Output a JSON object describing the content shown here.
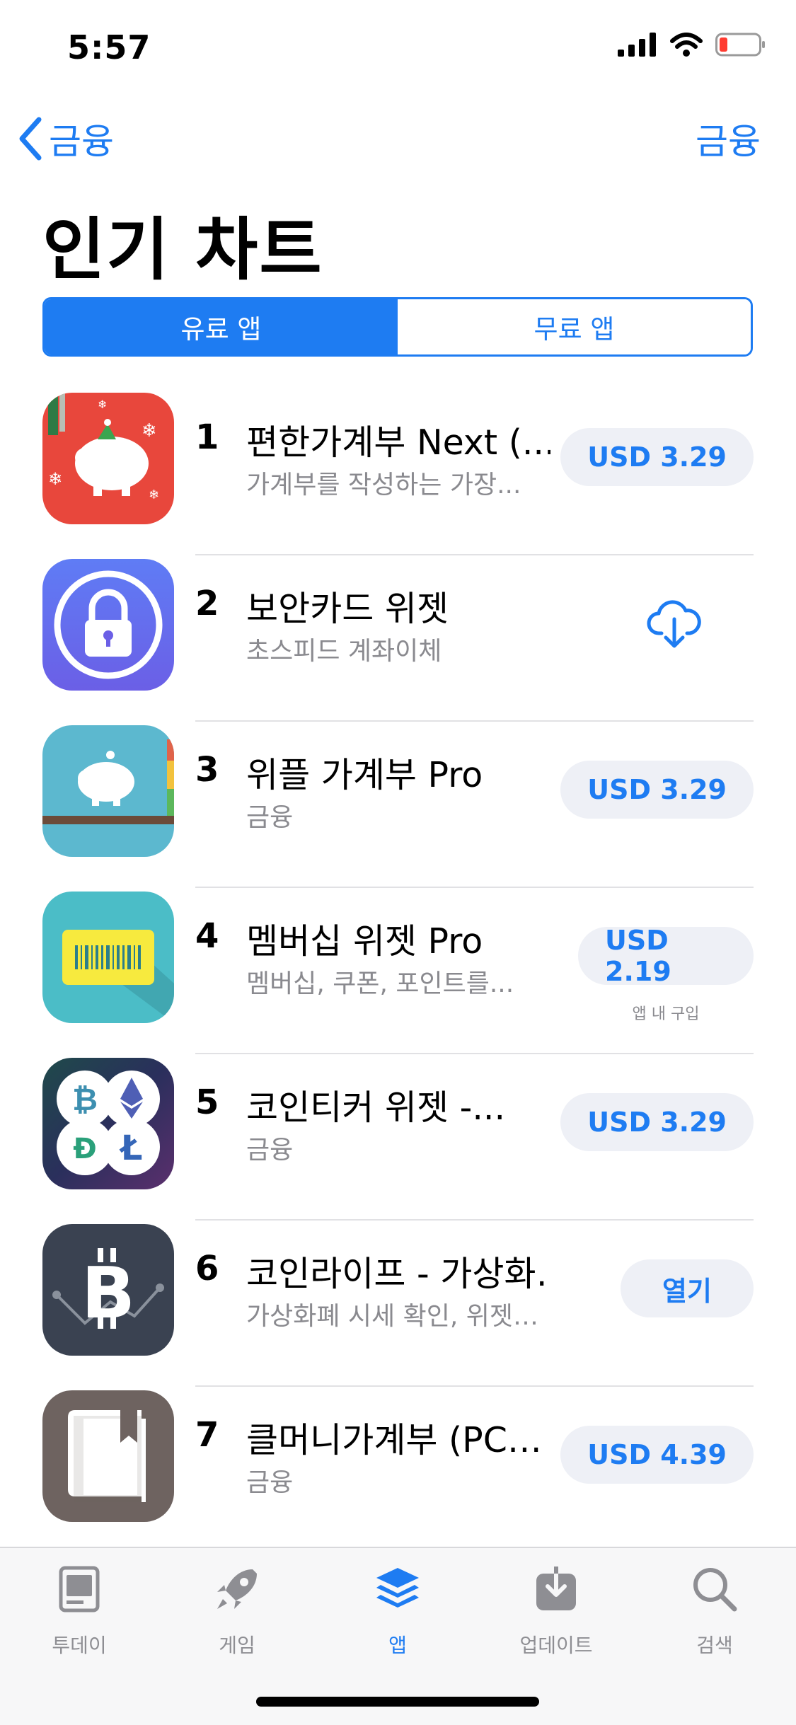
{
  "status": {
    "time": "5:57"
  },
  "nav": {
    "back_label": "금융",
    "right_label": "금융"
  },
  "page_title": "인기 차트",
  "segments": {
    "paid": "유료 앱",
    "free": "무료 앱"
  },
  "apps": [
    {
      "rank": "1",
      "title": "편한가계부 Next (...",
      "subtitle": "가계부를 작성하는 가장...",
      "action": "USD 3.29"
    },
    {
      "rank": "2",
      "title": "보안카드 위젯",
      "subtitle": "초스피드 계좌이체",
      "action_icon": "cloud-download-icon"
    },
    {
      "rank": "3",
      "title": "위플 가계부 Pro",
      "subtitle": "금융",
      "action": "USD 3.29"
    },
    {
      "rank": "4",
      "title": "멤버십 위젯 Pro",
      "subtitle": "멤버십, 쿠폰, 포인트를...",
      "action": "USD 2.19",
      "note": "앱 내 구입"
    },
    {
      "rank": "5",
      "title": "코인티커 위젯 -...",
      "subtitle": "금융",
      "action": "USD 3.29"
    },
    {
      "rank": "6",
      "title": "코인라이프 - 가상화…",
      "subtitle": "가상화폐 시세 확인, 위젯…",
      "action": "열기"
    },
    {
      "rank": "7",
      "title": "클머니가계부 (PC…",
      "subtitle": "금융",
      "action": "USD 4.39"
    }
  ],
  "tabbar": {
    "items": [
      {
        "label": "투데이",
        "icon": "today-icon"
      },
      {
        "label": "게임",
        "icon": "rocket-icon"
      },
      {
        "label": "앱",
        "icon": "apps-stack-icon",
        "active": true
      },
      {
        "label": "업데이트",
        "icon": "updates-icon"
      },
      {
        "label": "검색",
        "icon": "search-icon"
      }
    ]
  },
  "colors": {
    "accent": "#1e7cf2",
    "secondary_text": "#8a8a8f",
    "button_bg": "#eef0f6"
  }
}
